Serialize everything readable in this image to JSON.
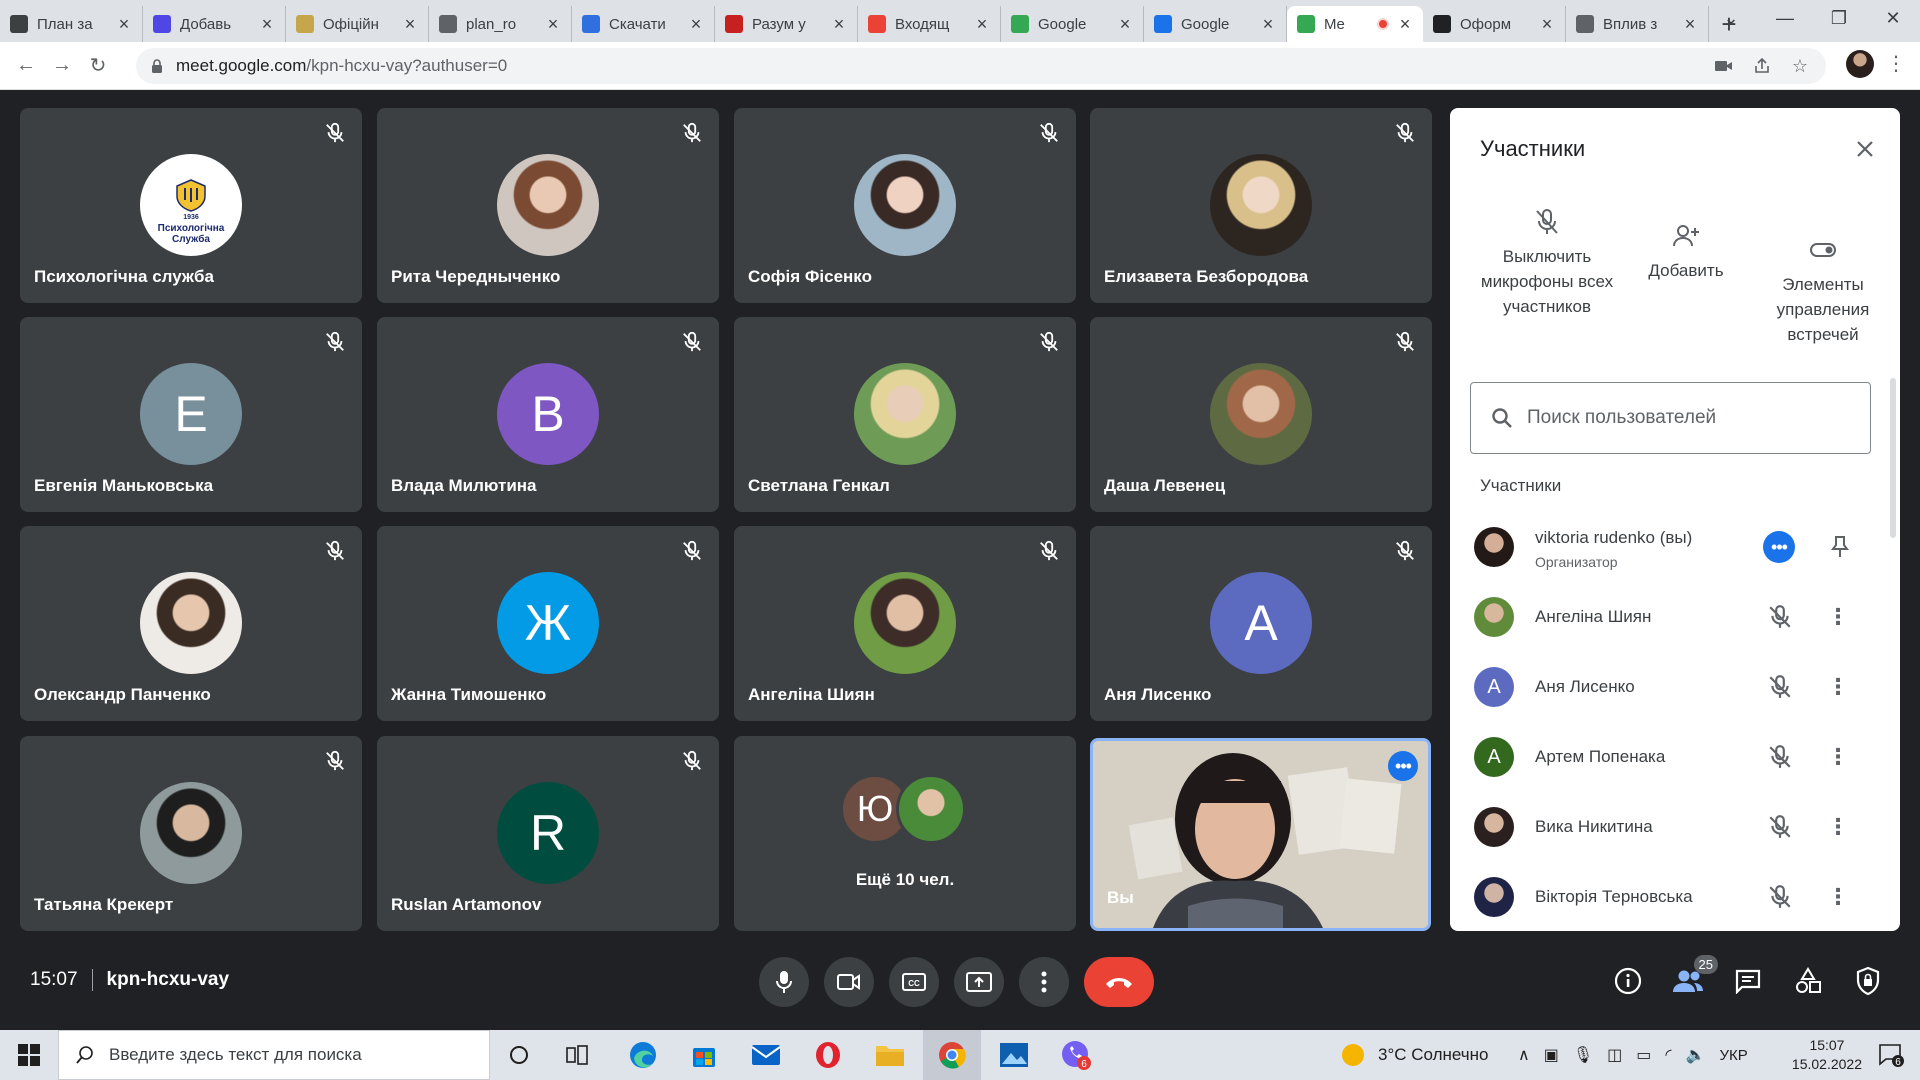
{
  "browser": {
    "tabs": [
      {
        "title": "План за",
        "color": "#3c4043",
        "icon": "graduation-cap-icon"
      },
      {
        "title": "Добавь",
        "color": "#4f46e5",
        "icon": "shield-icon"
      },
      {
        "title": "Офіційн",
        "color": "#c5a64a",
        "icon": "crest-icon"
      },
      {
        "title": "plan_ro",
        "color": "#5f6368",
        "icon": "globe-icon"
      },
      {
        "title": "Скачати",
        "color": "#2f6fde",
        "icon": "heart-icon"
      },
      {
        "title": "Разум у",
        "color": "#c5221f",
        "icon": "book-icon"
      },
      {
        "title": "Входящ",
        "color": "#ea4335",
        "icon": "gmail-icon"
      },
      {
        "title": "Google",
        "color": "#34a853",
        "icon": "meet-icon"
      },
      {
        "title": "Google",
        "color": "#1a73e8",
        "icon": "calendar-icon"
      },
      {
        "title": "Me",
        "color": "#34a853",
        "icon": "meet-icon",
        "active": true
      },
      {
        "title": "Оформ",
        "color": "#202124",
        "icon": "magnet-icon"
      },
      {
        "title": "Вплив з",
        "color": "#5f6368",
        "icon": "globe-icon"
      }
    ],
    "new_tab": "+",
    "url_host": "meet.google.com",
    "url_path": "/kpn-hcxu-vay?authuser=0"
  },
  "tiles": [
    {
      "name": "Психологічна служба",
      "type": "logo",
      "logo_text": "Психологічна Служба",
      "logo_year": "1936"
    },
    {
      "name": "Рита Чередныченко",
      "type": "photo",
      "tones": [
        "#e9c9b3",
        "#7b4a33",
        "#cfc6c0"
      ]
    },
    {
      "name": "Софія Фісенко",
      "type": "photo",
      "tones": [
        "#efd2c2",
        "#3a2a25",
        "#9fb6c6"
      ]
    },
    {
      "name": "Елизавета Безбородова",
      "type": "photo",
      "tones": [
        "#f0d8c6",
        "#d9c08a",
        "#2d2620"
      ]
    },
    {
      "name": "Евгенія Маньковська",
      "type": "letter",
      "letter": "Е",
      "color": "#78909c"
    },
    {
      "name": "Влада Милютина",
      "type": "letter",
      "letter": "В",
      "color": "#7e57c2"
    },
    {
      "name": "Светлана Генкал",
      "type": "photo",
      "tones": [
        "#e8cdb8",
        "#e3d49a",
        "#6e9c57"
      ]
    },
    {
      "name": "Даша Левенец",
      "type": "photo",
      "tones": [
        "#e2c0a8",
        "#a06848",
        "#5d6a42"
      ]
    },
    {
      "name": "Олександр Панченко",
      "type": "photo",
      "tones": [
        "#e6c7ae",
        "#3a2b23",
        "#eeeae6"
      ]
    },
    {
      "name": "Жанна Тимошенко",
      "type": "letter",
      "letter": "Ж",
      "color": "#039be5"
    },
    {
      "name": "Ангеліна Шиян",
      "type": "photo",
      "tones": [
        "#e1bfa4",
        "#3d2c28",
        "#6f9c45"
      ]
    },
    {
      "name": "Аня Лисенко",
      "type": "letter",
      "letter": "А",
      "color": "#5c6bc0"
    },
    {
      "name": "Татьяна Крекерт",
      "type": "photo",
      "tones": [
        "#d8b9a0",
        "#1e1e1e",
        "#8e9a9c"
      ]
    },
    {
      "name": "Ruslan Artamonov",
      "type": "letter",
      "letter": "R",
      "color": "#004d40"
    }
  ],
  "others_tile": {
    "label": "Ещё 10 чел.",
    "letter": "Ю",
    "letter_color": "#6d4c41"
  },
  "self_tile": {
    "name": "Вы"
  },
  "panel": {
    "title": "Участники",
    "actions": {
      "mute_all": "Выключить микрофоны всех участников",
      "add": "Добавить",
      "controls": "Элементы управления встречей"
    },
    "search_placeholder": "Поиск пользователей",
    "section": "Участники",
    "people": [
      {
        "name": "viktoria rudenko (вы)",
        "role": "Организатор",
        "type": "photo",
        "tones": [
          "#d4ae96",
          "#231a18"
        ]
      },
      {
        "name": "Ангеліна Шиян",
        "type": "photo",
        "tones": [
          "#d8b89c",
          "#5f8b3a"
        ]
      },
      {
        "name": "Аня Лисенко",
        "type": "letter",
        "letter": "А",
        "color": "#5c6bc0"
      },
      {
        "name": "Артем Попенака",
        "type": "letter",
        "letter": "А",
        "color": "#33691e"
      },
      {
        "name": "Вика Никитина",
        "type": "photo",
        "tones": [
          "#d7b6a0",
          "#2b2020"
        ]
      },
      {
        "name": "Вікторія Терновська",
        "type": "photo",
        "tones": [
          "#cfb4a6",
          "#1f2345"
        ]
      }
    ]
  },
  "footer": {
    "time": "15:07",
    "meeting_code": "kpn-hcxu-vay",
    "participants_count": "25"
  },
  "taskbar": {
    "search_placeholder": "Введите здесь текст для поиска",
    "weather": "3°C  Солнечно",
    "language": "УКР",
    "clock_time": "15:07",
    "clock_date": "15.02.2022",
    "notifications": "6",
    "viber_badge": "6"
  },
  "colors": {
    "meet_bg": "#202124",
    "tile_bg": "#3c4043",
    "accent": "#1a73e8",
    "hangup": "#ea4335"
  }
}
